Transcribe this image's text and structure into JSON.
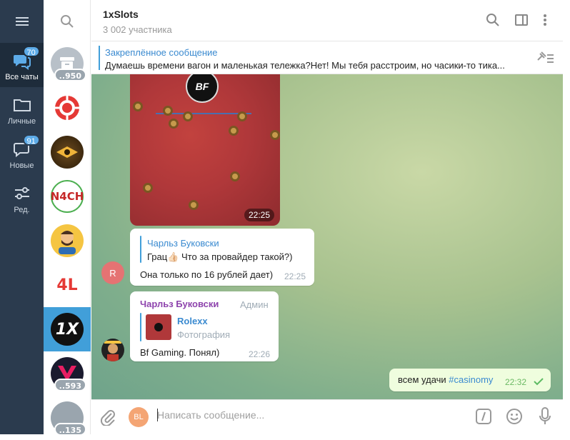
{
  "folders": [
    {
      "label": "Все чаты",
      "badge": "70",
      "icon": "chats-icon"
    },
    {
      "label": "Личные",
      "badge": "",
      "icon": "folder-icon"
    },
    {
      "label": "Новые",
      "badge": "91",
      "icon": "new-chats-icon"
    },
    {
      "label": "Ред.",
      "badge": "",
      "icon": "edit-folders-icon"
    }
  ],
  "chatlist": {
    "items": [
      {
        "unread": "950",
        "name": "archive"
      },
      {
        "unread": "",
        "name": "poker-chip"
      },
      {
        "unread": "",
        "name": "gold-logo"
      },
      {
        "unread": "",
        "name": "N4CH"
      },
      {
        "unread": "",
        "name": "bearded-avatar"
      },
      {
        "unread": "",
        "name": "4L"
      },
      {
        "unread": "",
        "name": "1X"
      },
      {
        "unread": "593",
        "name": "v-logo"
      },
      {
        "unread": "135",
        "name": "grey-avatar"
      }
    ],
    "text_n4ch": "N4CH",
    "text_4l": "4L",
    "text_1x": "1X"
  },
  "header": {
    "title": "1xSlots",
    "subtitle": "3 002 участника"
  },
  "pinned": {
    "title": "Закреплённое сообщение",
    "text": "Думаешь времени вагон и маленькая тележка?Нет!  Мы тебя расстроим, но часики-то тика..."
  },
  "messages": {
    "photo": {
      "logo": "BF",
      "time": "22:25"
    },
    "reply1": {
      "quote_author": "Чарльз Буковски",
      "quote_text": "Грац👍🏻 Что за провайдер такой?)",
      "text": "Она только по 16 рублей дает)",
      "time": "22:25",
      "avatar_letter": "R"
    },
    "reply2": {
      "author": "Чарльз Буковски",
      "role": "Админ",
      "quote_author": "Rolexx",
      "quote_text": "Фотография",
      "text": "Bf Gaming. Понял)",
      "time": "22:26"
    },
    "outgoing": {
      "text": "всем удачи ",
      "hashtag": "#casinomy",
      "time": "22:32"
    }
  },
  "composer": {
    "avatar": "BL",
    "placeholder": "Написать сообщение..."
  },
  "colors": {
    "rail": "#2b3b4e",
    "accent": "#419fd9",
    "outgoing": "#effdde"
  }
}
